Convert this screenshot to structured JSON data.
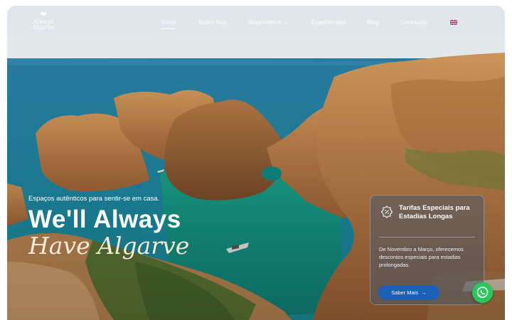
{
  "brand": {
    "logo_text": "Always Algarve"
  },
  "nav": {
    "items": [
      {
        "label": "Início",
        "active": true
      },
      {
        "label": "Sobre Nós"
      },
      {
        "label": "Alojamentos",
        "has_dropdown": true
      },
      {
        "label": "Experiências"
      },
      {
        "label": "Blog"
      },
      {
        "label": "Contactos"
      }
    ],
    "language_icon": "uk-flag-icon"
  },
  "hero": {
    "tagline": "Espaços autênticos para sentir-se em casa.",
    "headline_line1": "We'll Always",
    "headline_line2": "Have Algarve",
    "background": "coastal-cliffs-photo"
  },
  "promo_card": {
    "icon": "discount-badge-icon",
    "title": "Tarifas Especiais para Estadias Longas",
    "text": "De Novembro a Março, oferecemos descontos especiais para estadias prolongadas.",
    "button_label": "Saber Mais",
    "button_icon": "arrow-right-icon"
  },
  "whatsapp": {
    "icon": "whatsapp-icon"
  },
  "colors": {
    "accent_button": "#1c5fb4",
    "whatsapp": "#28c85b",
    "sea": "#1e8fa6",
    "cliff": "#c88a4d"
  }
}
